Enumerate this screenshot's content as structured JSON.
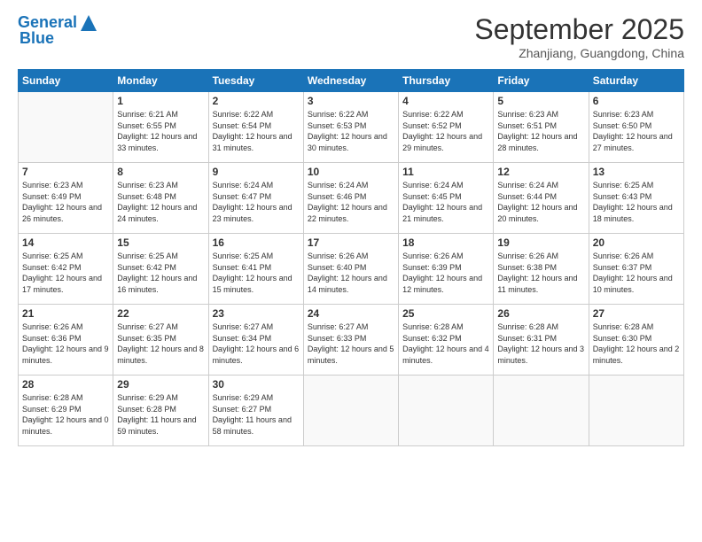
{
  "header": {
    "logo_line1": "General",
    "logo_line2": "Blue",
    "month_title": "September 2025",
    "location": "Zhanjiang, Guangdong, China"
  },
  "days_of_week": [
    "Sunday",
    "Monday",
    "Tuesday",
    "Wednesday",
    "Thursday",
    "Friday",
    "Saturday"
  ],
  "weeks": [
    [
      {
        "day": "",
        "empty": true
      },
      {
        "day": "1",
        "sunrise": "6:21 AM",
        "sunset": "6:55 PM",
        "daylight": "12 hours and 33 minutes."
      },
      {
        "day": "2",
        "sunrise": "6:22 AM",
        "sunset": "6:54 PM",
        "daylight": "12 hours and 31 minutes."
      },
      {
        "day": "3",
        "sunrise": "6:22 AM",
        "sunset": "6:53 PM",
        "daylight": "12 hours and 30 minutes."
      },
      {
        "day": "4",
        "sunrise": "6:22 AM",
        "sunset": "6:52 PM",
        "daylight": "12 hours and 29 minutes."
      },
      {
        "day": "5",
        "sunrise": "6:23 AM",
        "sunset": "6:51 PM",
        "daylight": "12 hours and 28 minutes."
      },
      {
        "day": "6",
        "sunrise": "6:23 AM",
        "sunset": "6:50 PM",
        "daylight": "12 hours and 27 minutes."
      }
    ],
    [
      {
        "day": "7",
        "sunrise": "6:23 AM",
        "sunset": "6:49 PM",
        "daylight": "12 hours and 26 minutes."
      },
      {
        "day": "8",
        "sunrise": "6:23 AM",
        "sunset": "6:48 PM",
        "daylight": "12 hours and 24 minutes."
      },
      {
        "day": "9",
        "sunrise": "6:24 AM",
        "sunset": "6:47 PM",
        "daylight": "12 hours and 23 minutes."
      },
      {
        "day": "10",
        "sunrise": "6:24 AM",
        "sunset": "6:46 PM",
        "daylight": "12 hours and 22 minutes."
      },
      {
        "day": "11",
        "sunrise": "6:24 AM",
        "sunset": "6:45 PM",
        "daylight": "12 hours and 21 minutes."
      },
      {
        "day": "12",
        "sunrise": "6:24 AM",
        "sunset": "6:44 PM",
        "daylight": "12 hours and 20 minutes."
      },
      {
        "day": "13",
        "sunrise": "6:25 AM",
        "sunset": "6:43 PM",
        "daylight": "12 hours and 18 minutes."
      }
    ],
    [
      {
        "day": "14",
        "sunrise": "6:25 AM",
        "sunset": "6:42 PM",
        "daylight": "12 hours and 17 minutes."
      },
      {
        "day": "15",
        "sunrise": "6:25 AM",
        "sunset": "6:42 PM",
        "daylight": "12 hours and 16 minutes."
      },
      {
        "day": "16",
        "sunrise": "6:25 AM",
        "sunset": "6:41 PM",
        "daylight": "12 hours and 15 minutes."
      },
      {
        "day": "17",
        "sunrise": "6:26 AM",
        "sunset": "6:40 PM",
        "daylight": "12 hours and 14 minutes."
      },
      {
        "day": "18",
        "sunrise": "6:26 AM",
        "sunset": "6:39 PM",
        "daylight": "12 hours and 12 minutes."
      },
      {
        "day": "19",
        "sunrise": "6:26 AM",
        "sunset": "6:38 PM",
        "daylight": "12 hours and 11 minutes."
      },
      {
        "day": "20",
        "sunrise": "6:26 AM",
        "sunset": "6:37 PM",
        "daylight": "12 hours and 10 minutes."
      }
    ],
    [
      {
        "day": "21",
        "sunrise": "6:26 AM",
        "sunset": "6:36 PM",
        "daylight": "12 hours and 9 minutes."
      },
      {
        "day": "22",
        "sunrise": "6:27 AM",
        "sunset": "6:35 PM",
        "daylight": "12 hours and 8 minutes."
      },
      {
        "day": "23",
        "sunrise": "6:27 AM",
        "sunset": "6:34 PM",
        "daylight": "12 hours and 6 minutes."
      },
      {
        "day": "24",
        "sunrise": "6:27 AM",
        "sunset": "6:33 PM",
        "daylight": "12 hours and 5 minutes."
      },
      {
        "day": "25",
        "sunrise": "6:28 AM",
        "sunset": "6:32 PM",
        "daylight": "12 hours and 4 minutes."
      },
      {
        "day": "26",
        "sunrise": "6:28 AM",
        "sunset": "6:31 PM",
        "daylight": "12 hours and 3 minutes."
      },
      {
        "day": "27",
        "sunrise": "6:28 AM",
        "sunset": "6:30 PM",
        "daylight": "12 hours and 2 minutes."
      }
    ],
    [
      {
        "day": "28",
        "sunrise": "6:28 AM",
        "sunset": "6:29 PM",
        "daylight": "12 hours and 0 minutes."
      },
      {
        "day": "29",
        "sunrise": "6:29 AM",
        "sunset": "6:28 PM",
        "daylight": "11 hours and 59 minutes."
      },
      {
        "day": "30",
        "sunrise": "6:29 AM",
        "sunset": "6:27 PM",
        "daylight": "11 hours and 58 minutes."
      },
      {
        "day": "",
        "empty": true
      },
      {
        "day": "",
        "empty": true
      },
      {
        "day": "",
        "empty": true
      },
      {
        "day": "",
        "empty": true
      }
    ]
  ]
}
